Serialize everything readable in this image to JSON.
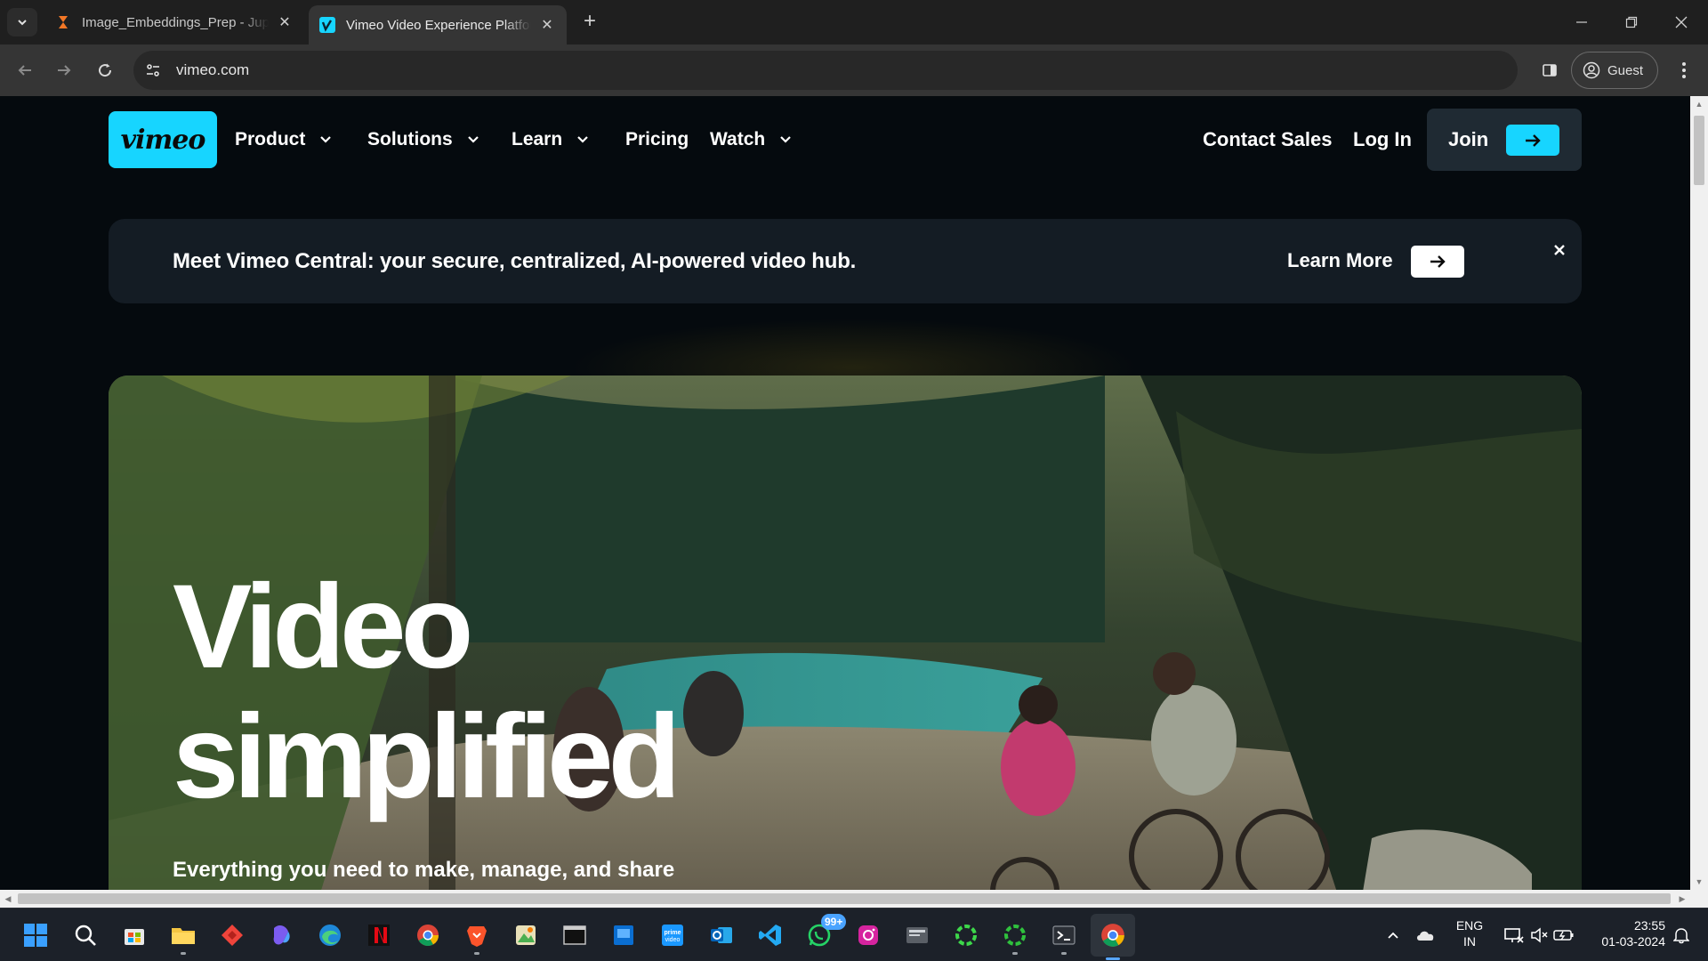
{
  "browser": {
    "tabs": [
      {
        "title": "Image_Embeddings_Prep - Jupyter",
        "favicon": "hourglass-icon",
        "active": false
      },
      {
        "title": "Vimeo Video Experience Platform",
        "favicon": "vimeo-v-icon",
        "active": true
      }
    ],
    "url": "vimeo.com",
    "profile_label": "Guest"
  },
  "site": {
    "logo_text": "vimeo",
    "nav": [
      {
        "label": "Product",
        "has_dropdown": true
      },
      {
        "label": "Solutions",
        "has_dropdown": true
      },
      {
        "label": "Learn",
        "has_dropdown": true
      },
      {
        "label": "Pricing",
        "has_dropdown": false
      },
      {
        "label": "Watch",
        "has_dropdown": true
      }
    ],
    "contact_sales": "Contact Sales",
    "log_in": "Log In",
    "join": "Join",
    "banner": {
      "message": "Meet Vimeo Central: your secure, centralized, AI-powered video hub.",
      "cta": "Learn More"
    },
    "hero": {
      "title_line1": "Video",
      "title_line2": "simplified",
      "subtitle": "Everything you need to make, manage, and share"
    },
    "accent_color": "#17d5ff"
  },
  "taskbar": {
    "apps": [
      "windows-start-icon",
      "search-icon",
      "store-icon",
      "file-explorer-icon",
      "anydesk-icon",
      "copilot-icon",
      "edge-icon",
      "netflix-icon",
      "chrome-icon",
      "brave-icon",
      "image-editor-icon",
      "terminal-window-icon",
      "windows-app-icon",
      "prime-video-icon",
      "outlook-icon",
      "vscode-icon",
      "whatsapp-icon",
      "instagram-icon",
      "virtual-machine-icon",
      "green-ring-app-icon",
      "green-ring-app-2-icon",
      "powershell-icon",
      "chrome-active-icon"
    ],
    "whatsapp_badge": "99+",
    "language_line1": "ENG",
    "language_line2": "IN",
    "time": "23:55",
    "date": "01-03-2024"
  }
}
